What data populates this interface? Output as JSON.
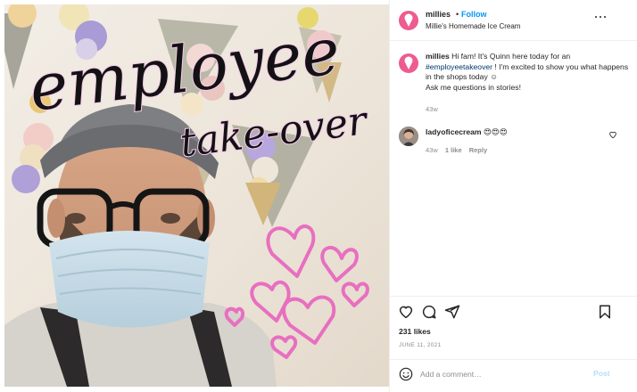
{
  "header": {
    "username": "millies",
    "separator": "•",
    "follow_label": "Follow",
    "subtitle": "Millie's Homemade Ice Cream",
    "more_icon": "more-horizontal-icon"
  },
  "image": {
    "title_line1": "employee",
    "title_line2": "take-over",
    "accent_pink": "#e86fc0",
    "heart_color": "#e86fc0"
  },
  "caption": {
    "username": "millies",
    "text_before_tag": "Hi fam! It's Quinn here today for an",
    "hashtag": "#employeetakeover",
    "text_after_tag": "! I'm excited to show you what happens in the shops today ☺",
    "text_line_last": "Ask me questions in stories!",
    "time": "43w"
  },
  "comment": {
    "username": "ladyoficecream",
    "text": "😍😍😍",
    "time": "43w",
    "likes": "1 like",
    "reply_label": "Reply"
  },
  "actions": {
    "likes": "231 likes",
    "date": "JUNE 11, 2021"
  },
  "add_comment": {
    "placeholder": "Add a comment…",
    "post_label": "Post"
  },
  "colors": {
    "brand_pink": "#ee5b8f",
    "link_blue": "#0095f6",
    "post_disabled": "#b2dffc",
    "muted": "#8e8e8e"
  }
}
